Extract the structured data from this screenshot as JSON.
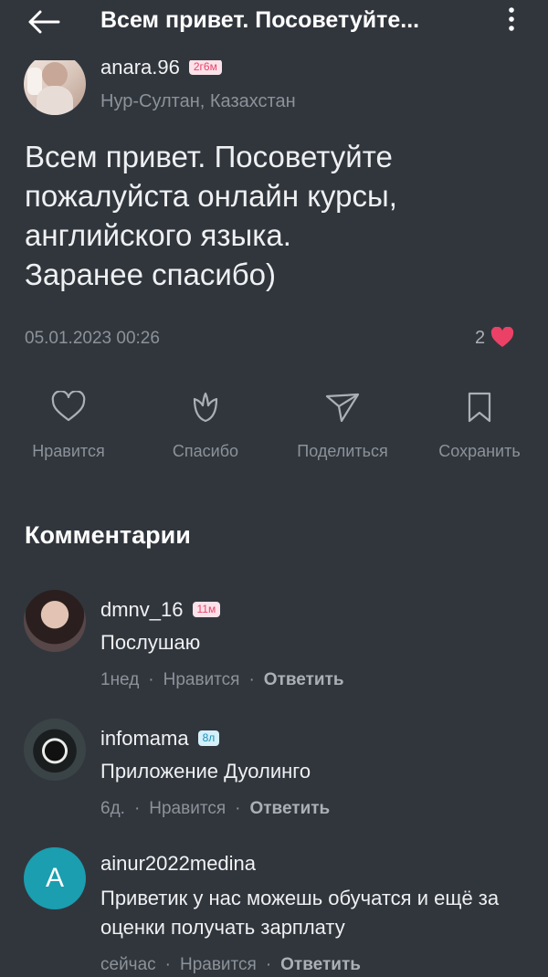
{
  "header": {
    "title": "Всем привет. Посоветуйте..."
  },
  "post": {
    "author": "anara.96",
    "badge": "2г6м",
    "location": "Нур-Султан, Казахстан",
    "text": "Всем привет. Посоветуйте\nпожалуйста онлайн курсы,\nанглийского языка.\nЗаранее спасибо)",
    "date": "05.01.2023 00:26",
    "likes": "2",
    "actions": [
      {
        "label": "Нравится",
        "icon": "heart-outline-icon"
      },
      {
        "label": "Спасибо",
        "icon": "flower-icon"
      },
      {
        "label": "Поделиться",
        "icon": "send-icon"
      },
      {
        "label": "Сохранить",
        "icon": "bookmark-icon"
      }
    ]
  },
  "comments_title": "Комментарии",
  "comments": [
    {
      "author": "dmnv_16",
      "badge": "11м",
      "text": "Послушаю",
      "time": "1нед",
      "like": "Нравится",
      "reply": "Ответить"
    },
    {
      "author": "infomama",
      "badge": "8л",
      "text": "Приложение Дуолинго",
      "time": "6д.",
      "like": "Нравится",
      "reply": "Ответить"
    },
    {
      "author": "ainur2022medina",
      "avatar_letter": "A",
      "text": "Приветик у нас можешь обучатся и ещё за оценки получать зарплату",
      "time": "сейчас",
      "like": "Нравится",
      "reply": "Ответить"
    }
  ],
  "colors": {
    "background": "#31363d",
    "like_heart": "#ec4166",
    "avatar_teal": "#1a9eb0"
  }
}
